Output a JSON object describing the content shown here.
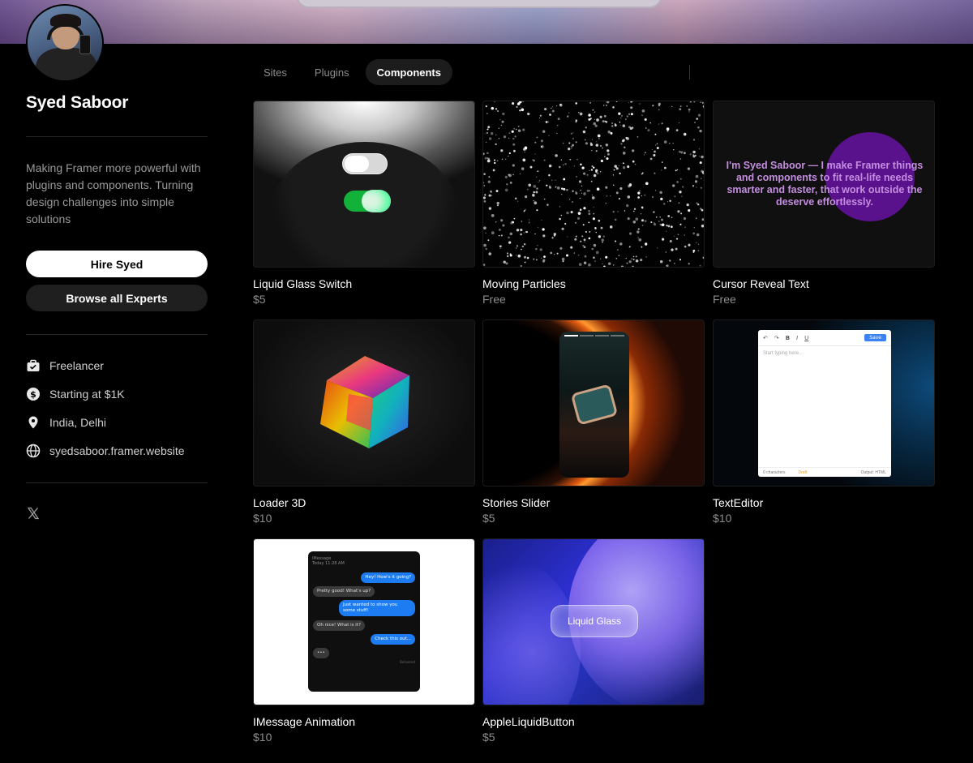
{
  "profile": {
    "name": "Syed Saboor",
    "bio": "Making Framer more powerful with plugins and components. Turning design challenges into simple solutions",
    "hire_label": "Hire Syed",
    "browse_label": "Browse all Experts",
    "meta": {
      "role": "Freelancer",
      "rate": "Starting at $1K",
      "location": "India, Delhi",
      "website": "syedsaboor.framer.website"
    }
  },
  "tabs": [
    {
      "label": "Sites",
      "active": false
    },
    {
      "label": "Plugins",
      "active": false
    },
    {
      "label": "Components",
      "active": true
    }
  ],
  "components": [
    {
      "title": "Liquid Glass Switch",
      "price": "$5"
    },
    {
      "title": "Moving Particles",
      "price": "Free"
    },
    {
      "title": "Cursor Reveal Text",
      "price": "Free"
    },
    {
      "title": "Loader 3D",
      "price": "$10"
    },
    {
      "title": "Stories Slider",
      "price": "$5"
    },
    {
      "title": "TextEditor",
      "price": "$10"
    },
    {
      "title": "IMessage Animation",
      "price": "$10"
    },
    {
      "title": "AppleLiquidButton",
      "price": "$5"
    }
  ],
  "thumb_text": {
    "cursor_reveal": "I'm Syed Saboor — I make Framer things and components to fit real-life needs smarter and faster, that work outside the deserve effortlessly.",
    "editor_save": "Save",
    "editor_placeholder": "Start typing here...",
    "editor_chars": "0 characters",
    "editor_draft": "Draft",
    "editor_output": "Output: HTML",
    "imsg_header": "iMessage",
    "imsg_time": "Today 11:28 AM",
    "imsg_1": "Hey! How's it going?",
    "imsg_2": "Pretty good! What's up?",
    "imsg_3": "Just wanted to show you some stuff!",
    "imsg_4": "Oh nice! What is it?",
    "imsg_5": "Check this out...",
    "imsg_6": "•••",
    "imsg_delivered": "Delivered",
    "liquid_label": "Liquid Glass"
  },
  "icons": {
    "role": "briefcase-icon",
    "rate": "dollar-icon",
    "location": "pin-icon",
    "website": "globe-icon",
    "social": "x-icon"
  }
}
